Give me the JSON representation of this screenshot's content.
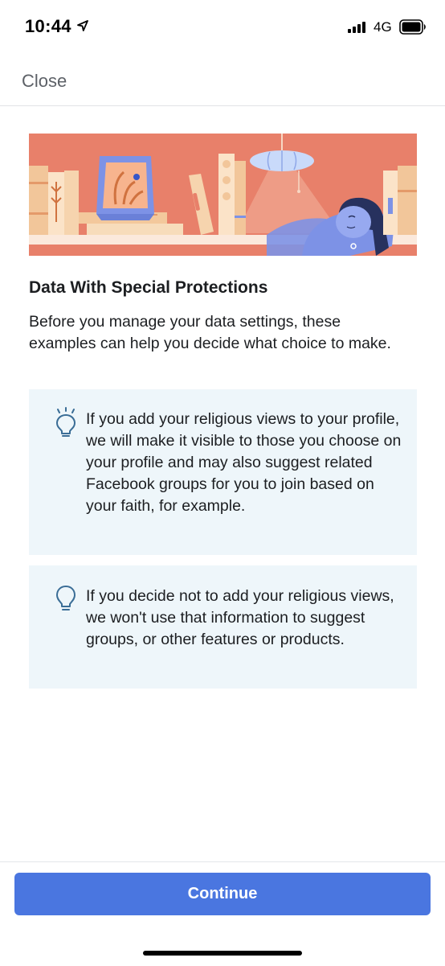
{
  "status_bar": {
    "time": "10:44",
    "network": "4G",
    "icons": [
      "location-arrow-icon",
      "signal-bars-icon",
      "battery-icon"
    ]
  },
  "nav": {
    "close_label": "Close"
  },
  "hero": {
    "icon": "bookshelf-illustration",
    "colors": {
      "background": "#e8806a",
      "shelf": "#fbe9dc",
      "accent": "#7d92e6"
    }
  },
  "content": {
    "title": "Data With Special Protections",
    "intro": "Before you manage your data settings, these examples can help you decide what choice to make."
  },
  "cards": [
    {
      "icon": "lightbulb-on-icon",
      "text": "If you add your religious views to your profile, we will make it visible to those you choose on your profile and may also suggest related Facebook groups for you to join based on your faith, for example."
    },
    {
      "icon": "lightbulb-icon",
      "text": "If you decide not to add your religious views, we won't use that information to suggest groups, or other features or products."
    }
  ],
  "footer": {
    "continue_label": "Continue"
  },
  "colors": {
    "primary_button": "#4a76e0",
    "card_background": "#eef6fa",
    "icon_stroke": "#3a6d96"
  }
}
